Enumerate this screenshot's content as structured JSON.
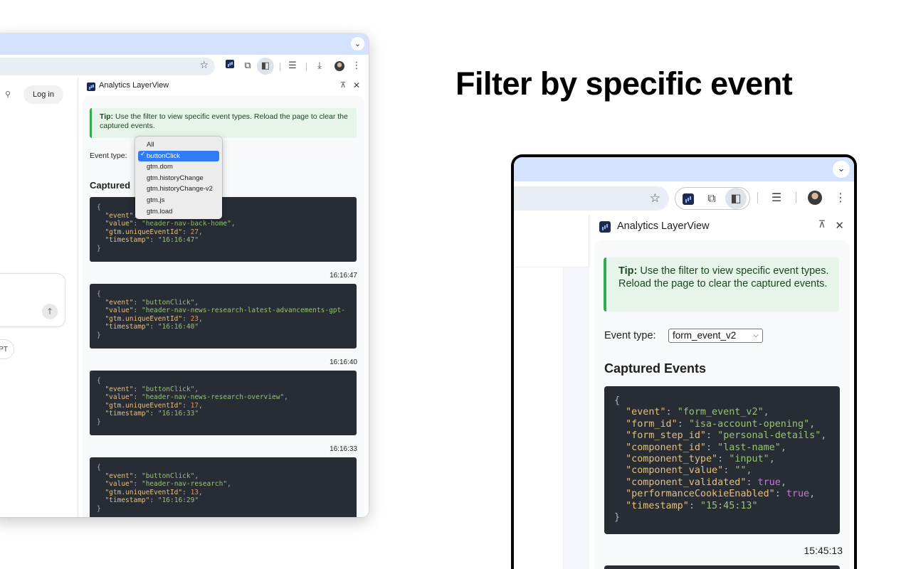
{
  "headline": "Filter by specific event",
  "left_window": {
    "site": {
      "login_label": "Log in",
      "pill_label": "PT"
    },
    "panel": {
      "title": "Analytics LayerView",
      "tip_bold": "Tip:",
      "tip_text": " Use the filter to view specific event types. Reload the page to clear the captured events.",
      "event_type_label": "Event type:",
      "captured_heading": "Captured",
      "dropdown_options": [
        "All",
        "buttonClick",
        "gtm.dom",
        "gtm.historyChange",
        "gtm.historyChange-v2",
        "gtm.js",
        "gtm.load"
      ],
      "dropdown_selected": "buttonClick",
      "events": [
        {
          "event": "buttonClick",
          "value": "header-nav-back-home",
          "id": "27",
          "timestamp": "16:16:47"
        },
        {
          "event": "buttonClick",
          "value": "header-nav-news-research-latest-advancements-gpt-",
          "id": "23",
          "timestamp": "16:16:40"
        },
        {
          "event": "buttonClick",
          "value": "header-nav-news-research-overview",
          "id": "17",
          "timestamp": "16:16:33"
        },
        {
          "event": "buttonClick",
          "value": "header-nav-research",
          "id": "13",
          "timestamp": "16:16:29"
        }
      ]
    }
  },
  "right_window": {
    "panel": {
      "title": "Analytics LayerView",
      "tip_bold": "Tip:",
      "tip_text": " Use the filter to view specific event types. Reload the page to clear the captured events.",
      "event_type_label": "Event type:",
      "selected_event_type": "form_event_v2",
      "captured_heading": "Captured Events",
      "event": {
        "event": "form_event_v2",
        "form_id": "isa-account-opening",
        "form_step_id": "personal-details",
        "component_id": "last-name",
        "component_type": "input",
        "component_value": "",
        "component_validated": "true",
        "performanceCookieEnabled": "true",
        "timestamp": "15:45:13"
      },
      "event_time": "15:45:13"
    }
  },
  "icons": {
    "star": "bookmark-star-icon",
    "extension": "puzzle-extension-icon",
    "side_panel": "side-panel-icon",
    "reading_list": "reading-list-icon",
    "download": "download-icon",
    "menu": "kebab-menu-icon",
    "pin": "unpin-icon",
    "close": "close-icon",
    "search": "search-icon",
    "send": "arrow-up-icon"
  },
  "colors": {
    "tabstrip": "#d3e3fd",
    "tip_bg": "#e6f4ea",
    "tip_border": "#34a853",
    "code_bg": "#282c34",
    "json_key": "#e5c07b",
    "json_string": "#98c379",
    "json_bool": "#c678dd",
    "dropdown_highlight": "#2f7cf6"
  }
}
